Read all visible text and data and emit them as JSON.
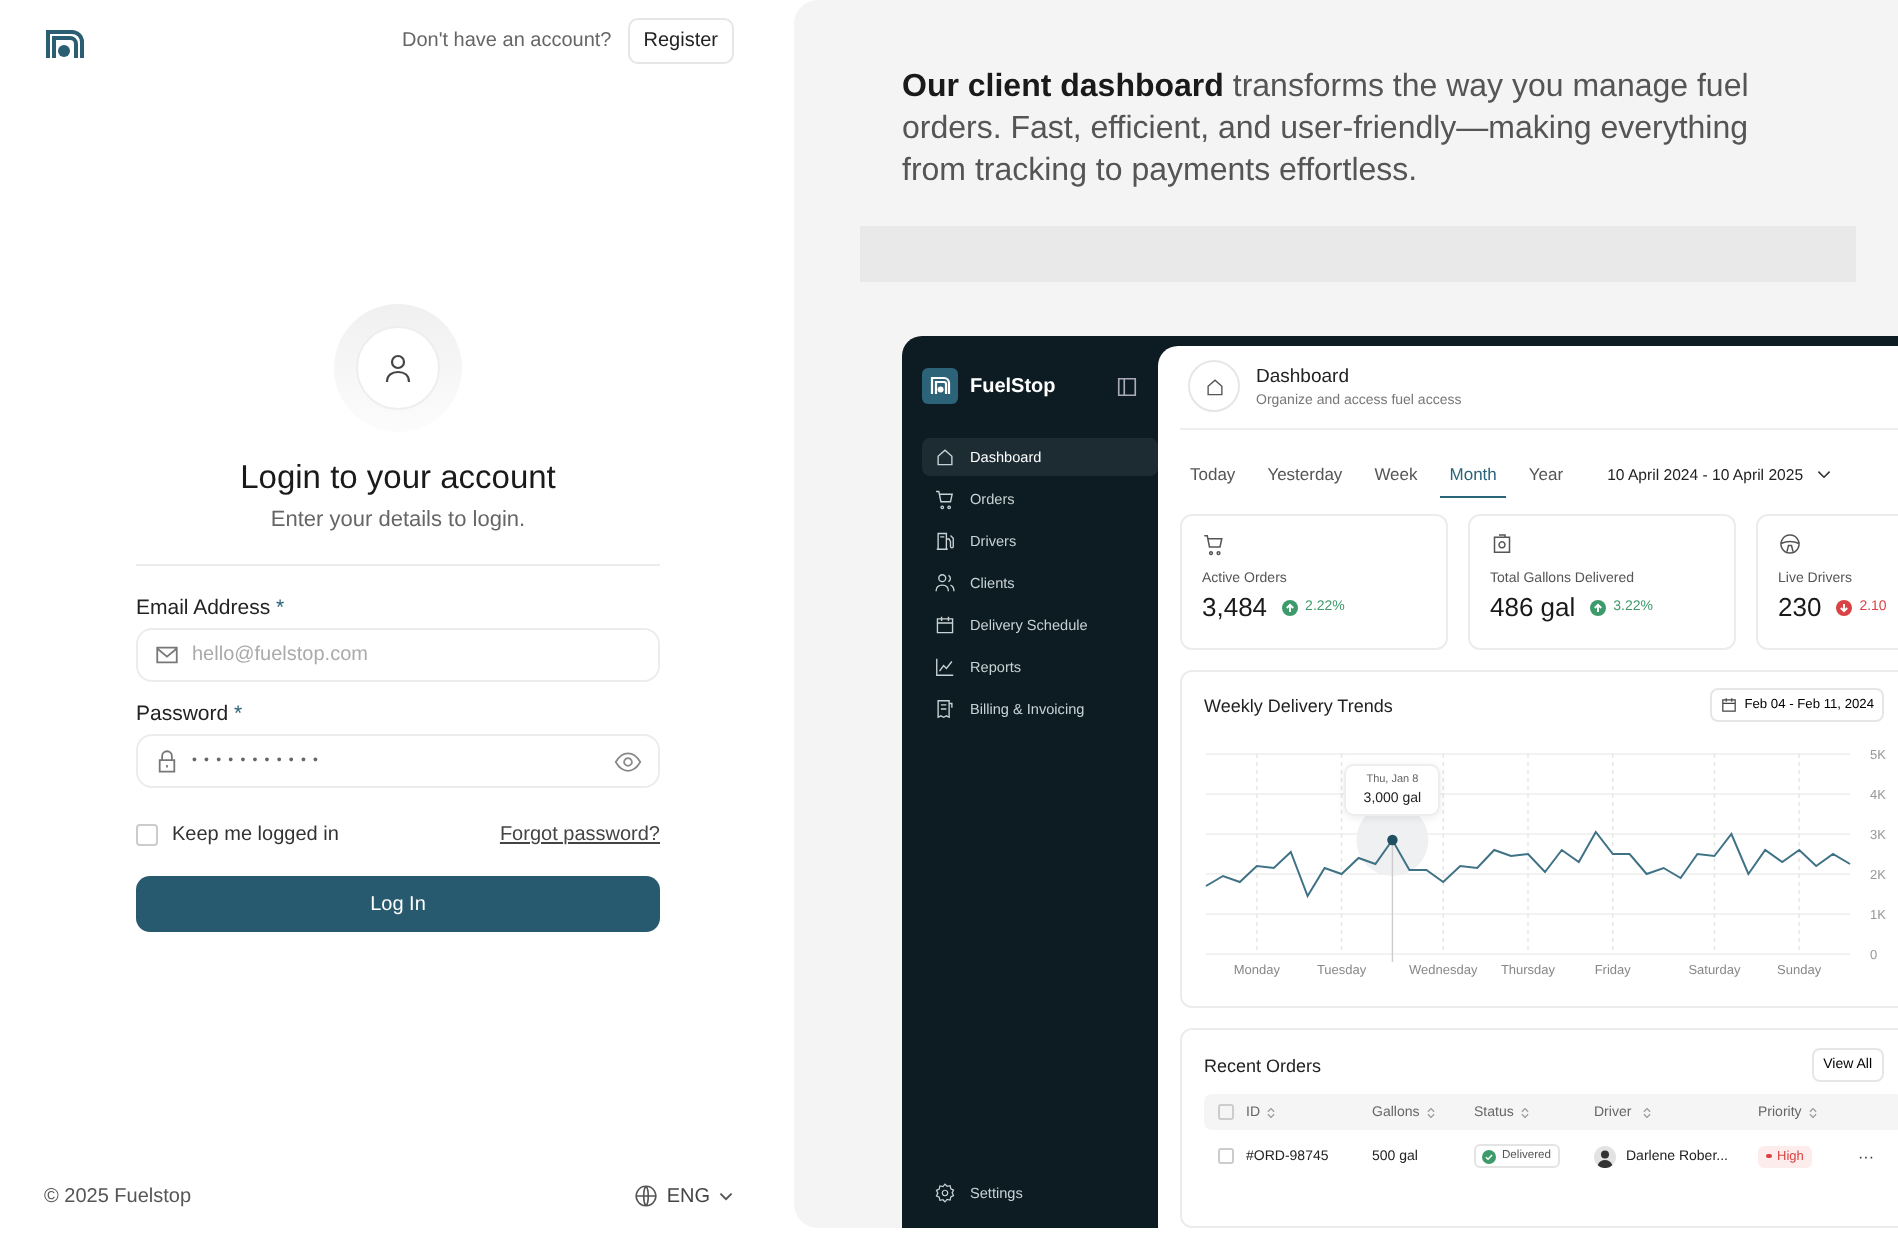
{
  "header": {
    "prompt": "Don't have an account?",
    "register": "Register"
  },
  "login": {
    "title": "Login to your account",
    "subtitle": "Enter your details to login.",
    "fields": [
      {
        "kind": "email",
        "label": "Email Address",
        "required_mark": "*",
        "placeholder": "hello@fuelstop.com"
      },
      {
        "kind": "password",
        "label": "Password",
        "required_mark": "*",
        "value": "•••••••••••"
      }
    ],
    "remember": {
      "label": "Keep me logged in",
      "checked": false
    },
    "forgot": "Forgot password?",
    "submit": "Log In"
  },
  "footer": {
    "copyright": "© 2025 Fuelstop",
    "language": "ENG"
  },
  "promo": {
    "text": "**Our client dashboard** transforms the way you manage fuel orders. Fast, efficient, and user-friendly—making everything from tracking to payments effortless."
  },
  "dashboard": {
    "brand": "FuelStop",
    "sidebar": {
      "items": [
        {
          "label": "Dashboard",
          "selected": true
        },
        {
          "label": "Orders",
          "selected": false
        },
        {
          "label": "Drivers",
          "selected": false
        },
        {
          "label": "Clients",
          "selected": false
        },
        {
          "label": "Delivery Schedule",
          "selected": false
        },
        {
          "label": "Reports",
          "selected": false
        },
        {
          "label": "Billing & Invoicing",
          "selected": false
        }
      ],
      "footer_item": "Settings"
    },
    "page": {
      "title": "Dashboard",
      "subtitle": "Organize and access fuel access"
    },
    "tabs": [
      {
        "label": "Today",
        "selected": false
      },
      {
        "label": "Yesterday",
        "selected": false
      },
      {
        "label": "Week",
        "selected": false
      },
      {
        "label": "Month",
        "selected": true
      },
      {
        "label": "Year",
        "selected": false
      }
    ],
    "date_range": "10 April 2024 - 10 April 2025",
    "stats": [
      {
        "label": "Active Orders",
        "value": "3,484",
        "change": "2.22%",
        "kind": "increase"
      },
      {
        "label": "Total Gallons Delivered",
        "value": "486 gal",
        "change": "3.22%",
        "kind": "increase"
      },
      {
        "label": "Live Drivers",
        "value": "230",
        "change": "2.10",
        "kind": "decrease"
      }
    ],
    "trend_chart": {
      "title": "Weekly Delivery Trends",
      "date_filter": "Feb 04 - Feb 11, 2024",
      "tooltip": {
        "date": "Thu, Jan 8",
        "value": "3,000 gal"
      },
      "chart_data": {
        "type": "line",
        "categories": [
          null,
          null,
          null,
          "Monday",
          null,
          null,
          null,
          null,
          "Tuesday",
          null,
          null,
          null,
          null,
          null,
          "Wednesday",
          null,
          null,
          null,
          null,
          "Thursday",
          null,
          null,
          null,
          null,
          "Friday",
          null,
          null,
          null,
          null,
          null,
          "Saturday",
          null,
          null,
          null,
          null,
          "Sunday",
          null,
          null,
          null
        ],
        "grid": true,
        "series": [
          {
            "color": "#3f7285",
            "values": [
              1.7,
              1.95,
              1.8,
              2.2,
              2.15,
              2.55,
              1.45,
              2.15,
              2.0,
              2.4,
              2.25,
              2.85,
              2.1,
              2.1,
              1.8,
              2.2,
              2.15,
              2.6,
              2.45,
              2.5,
              2.05,
              2.6,
              2.3,
              3.05,
              2.5,
              2.5,
              2.0,
              2.15,
              1.9,
              2.5,
              2.45,
              3.0,
              2.0,
              2.6,
              2.3,
              2.6,
              2.2,
              2.5,
              2.25
            ]
          }
        ],
        "ylim": [
          0,
          5
        ],
        "yticks": [
          {
            "value": 0,
            "label": "0"
          },
          {
            "value": 1,
            "label": "1K"
          },
          {
            "value": 2,
            "label": "2K"
          },
          {
            "value": 3,
            "label": "3K"
          },
          {
            "value": 4,
            "label": "4K"
          },
          {
            "value": 5,
            "label": "5K"
          }
        ]
      }
    },
    "orders": {
      "title": "Recent Orders",
      "view_all": "View All",
      "select_all": {
        "checked": false
      },
      "columns": [
        "ID",
        "Gallons",
        "Status",
        "Driver",
        "Priority"
      ],
      "rows": [
        {
          "checked": false,
          "id": "#ORD-98745",
          "gallons": "500 gal",
          "status": "Delivered",
          "driver": "Darlene Rober...",
          "priority": "High",
          "more": "···"
        }
      ]
    }
  }
}
